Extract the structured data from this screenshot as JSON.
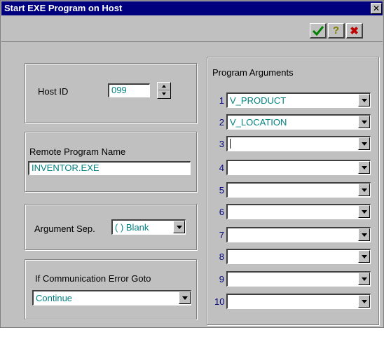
{
  "window": {
    "title": "Start EXE Program on Host"
  },
  "toolbar": {
    "ok_icon": "checkmark-icon",
    "help_icon": "question-mark-icon",
    "cancel_icon": "red-x-icon"
  },
  "host": {
    "label": "Host ID",
    "value": "099"
  },
  "remote": {
    "label": "Remote Program Name",
    "value": "INVENTOR.EXE"
  },
  "argsep": {
    "label": "Argument Sep.",
    "value": "( ) Blank"
  },
  "commerr": {
    "label": "If Communication Error Goto",
    "value": "Continue"
  },
  "args": {
    "title": "Program Arguments",
    "items": [
      {
        "num": "1",
        "value": "V_PRODUCT"
      },
      {
        "num": "2",
        "value": "V_LOCATION"
      },
      {
        "num": "3",
        "value": ""
      },
      {
        "num": "4",
        "value": ""
      },
      {
        "num": "5",
        "value": ""
      },
      {
        "num": "6",
        "value": ""
      },
      {
        "num": "7",
        "value": ""
      },
      {
        "num": "8",
        "value": ""
      },
      {
        "num": "9",
        "value": ""
      },
      {
        "num": "10",
        "value": ""
      }
    ]
  }
}
